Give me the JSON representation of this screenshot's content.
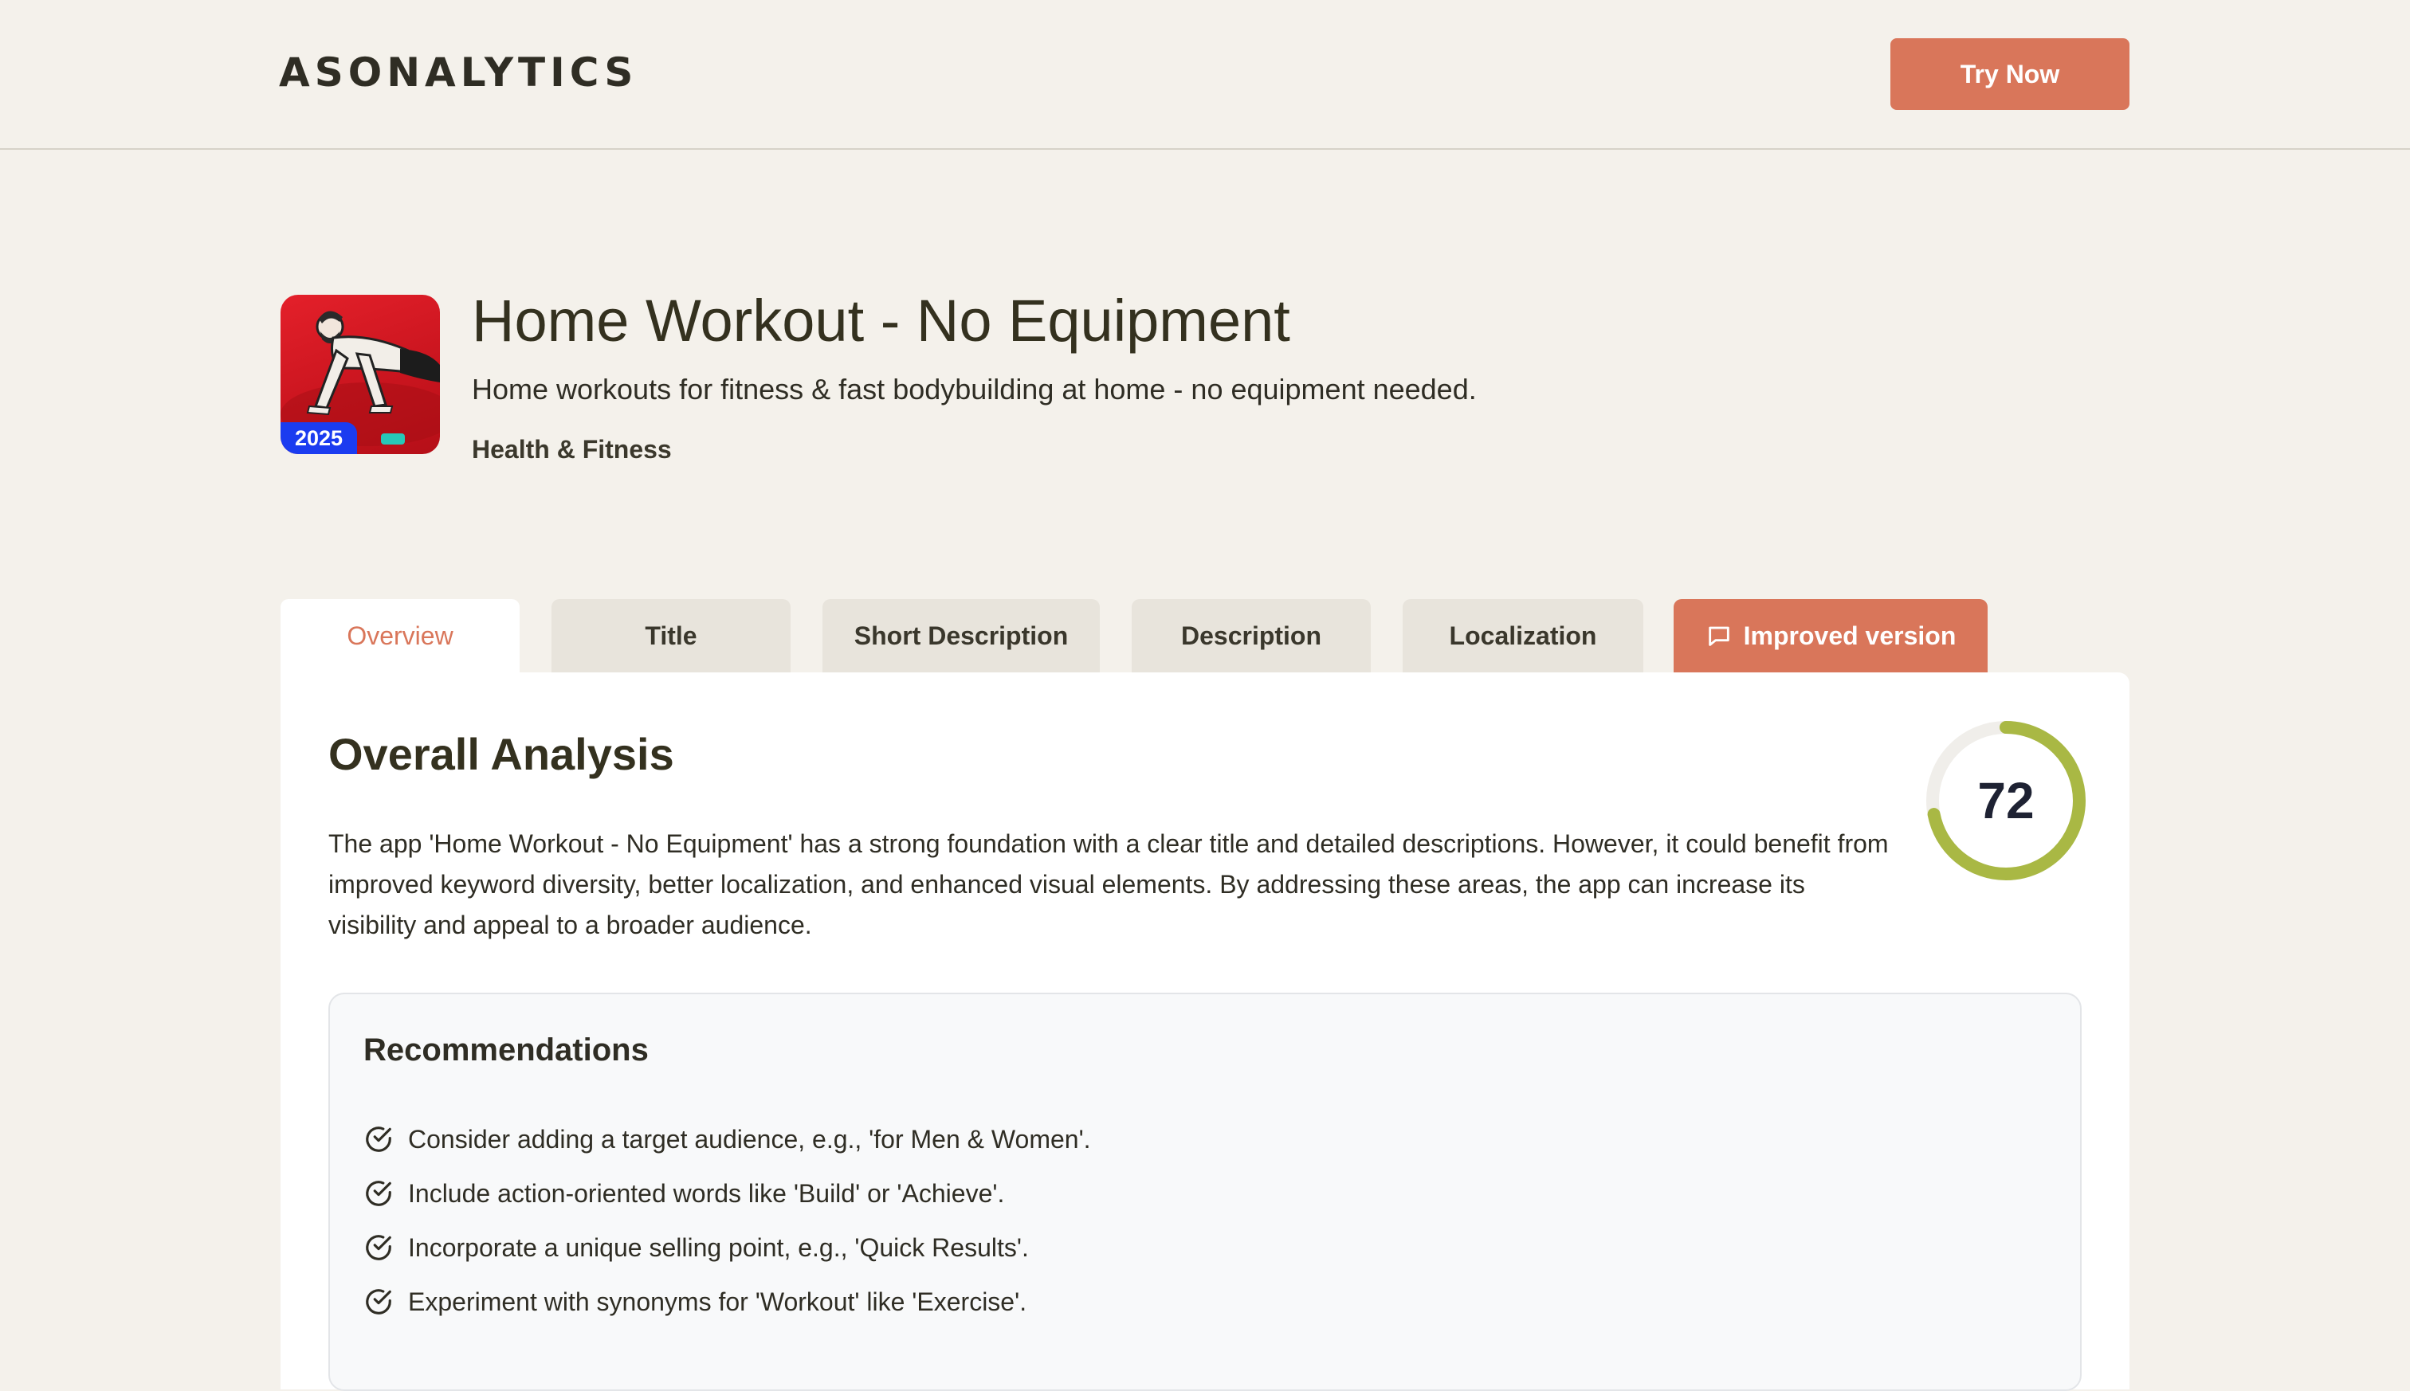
{
  "header": {
    "logo": "ASONALYTICS",
    "cta_label": "Try Now"
  },
  "app": {
    "icon_badge": "2025",
    "title": "Home Workout - No Equipment",
    "subtitle": "Home workouts for fitness & fast bodybuilding at home - no equipment needed.",
    "category": "Health & Fitness"
  },
  "tabs": [
    {
      "label": "Overview",
      "active": true
    },
    {
      "label": "Title"
    },
    {
      "label": "Short Description"
    },
    {
      "label": "Description"
    },
    {
      "label": "Localization"
    },
    {
      "label": "Improved version",
      "icon": "chat-icon"
    }
  ],
  "overview": {
    "heading": "Overall Analysis",
    "summary": "The app 'Home Workout - No Equipment' has a strong foundation with a clear title and detailed descriptions. However, it could benefit from improved keyword diversity, better localization, and enhanced visual elements. By addressing these areas, the app can increase its visibility and appeal to a broader audience.",
    "score": "72",
    "score_fraction": 0.72,
    "score_color": "#a9b844",
    "recommendations_title": "Recommendations",
    "recommendations": [
      "Consider adding a target audience, e.g., 'for Men & Women'.",
      "Include action-oriented words like 'Build' or 'Achieve'.",
      "Incorporate a unique selling point, e.g., 'Quick Results'.",
      "Experiment with synonyms for 'Workout' like 'Exercise'."
    ]
  },
  "colors": {
    "accent": "#d9765a",
    "background": "#f4f1eb"
  }
}
